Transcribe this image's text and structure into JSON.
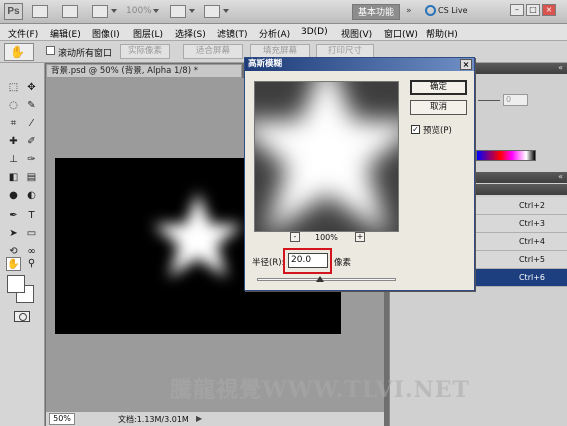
{
  "appbar": {
    "logo": "Ps",
    "zoom": "100%",
    "workspace": "基本功能",
    "workspace_more": "»",
    "cslive": "CS Live",
    "win_min": "–",
    "win_max": "□",
    "win_close": "×"
  },
  "menubar": {
    "items": [
      "文件(F)",
      "编辑(E)",
      "图像(I)",
      "图层(L)",
      "选择(S)",
      "滤镜(T)",
      "分析(A)",
      "3D(D)",
      "视图(V)",
      "窗口(W)",
      "帮助(H)"
    ]
  },
  "options": {
    "scroll_all_windows": "滚动所有窗口",
    "actual_pixels": "实际像素",
    "fit_screen": "适合屏幕",
    "fill_screen": "填充屏幕",
    "print_size": "打印尺寸"
  },
  "document": {
    "tab_title": "背景.psd @ 50% (背景, Alpha 1/8) *",
    "tab_close": "×",
    "zoom": "50%",
    "doc_size": "文档:1.13M/3.01M",
    "arrow": "▶"
  },
  "panels": {
    "opacity_value": "0",
    "shortcuts": [
      "Ctrl+2",
      "Ctrl+3",
      "Ctrl+4",
      "Ctrl+5",
      "Ctrl+6"
    ],
    "selected_index": 4
  },
  "dialog": {
    "title": "高斯模糊",
    "ok": "确定",
    "cancel": "取消",
    "preview_label": "预览(P)",
    "preview_checked": true,
    "zoom_out": "-",
    "zoom_in": "+",
    "zoom_pct": "100%",
    "radius_label": "半径(R):",
    "radius_value": "20.0",
    "radius_unit": "像素",
    "radius_slider_fraction": 0.45
  },
  "watermark": "騰龍視覺WWW.TLVI.NET",
  "colors": {
    "dialog_title": "#1d3b78",
    "highlight": "#d4141c",
    "selected_row": "#1e3f7f"
  }
}
